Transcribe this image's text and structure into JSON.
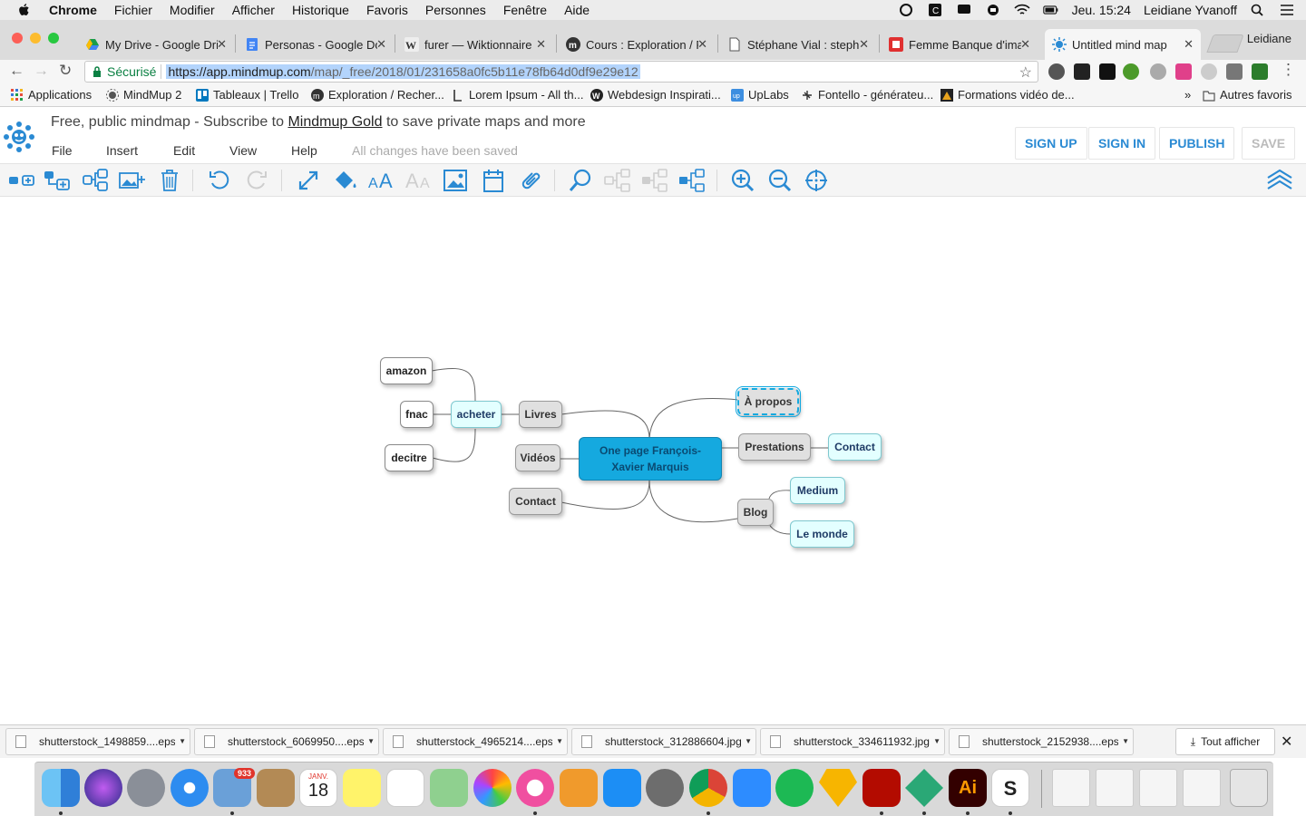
{
  "menubar": {
    "app_name": "Chrome",
    "items": [
      "Fichier",
      "Modifier",
      "Afficher",
      "Historique",
      "Favoris",
      "Personnes",
      "Fenêtre",
      "Aide"
    ],
    "datetime": "Jeu. 15:24",
    "user": "Leidiane Yvanoff"
  },
  "tabs": [
    {
      "title": "My Drive - Google Dri",
      "favicon_color": "#1a9c4a"
    },
    {
      "title": "Personas - Google Do",
      "favicon_color": "#4285f4"
    },
    {
      "title": "furer — Wiktionnaire",
      "favicon_color": "#777777"
    },
    {
      "title": "Cours : Exploration / F",
      "favicon_color": "#333333"
    },
    {
      "title": "Stéphane Vial : stepha",
      "favicon_color": "#ffffff"
    },
    {
      "title": "Femme Banque d'imag",
      "favicon_color": "#e03030"
    },
    {
      "title": "Untitled mind map",
      "favicon_color": "#2a8ad3"
    }
  ],
  "profile_name": "Leidiane",
  "omnibox": {
    "secure_label": "Sécurisé",
    "url_host": "https://app.mindmup.com",
    "url_path": "/map/_free/2018/01/231658a0fc5b11e78fb64d0df9e29e12"
  },
  "bookmarks": [
    {
      "label": "Applications",
      "icon": "apps-grid-icon",
      "color": "#e74c3c"
    },
    {
      "label": "MindMup 2",
      "icon": "mindmup-icon",
      "color": "#2a8ad3"
    },
    {
      "label": "Tableaux | Trello",
      "icon": "trello-icon",
      "color": "#0079bf"
    },
    {
      "label": "Exploration / Recher...",
      "icon": "moodle-icon",
      "color": "#333333"
    },
    {
      "label": "Lorem Ipsum - All th...",
      "icon": "lorem-icon",
      "color": "#444444"
    },
    {
      "label": "Webdesign Inspirati...",
      "icon": "webdesign-icon",
      "color": "#222222"
    },
    {
      "label": "UpLabs",
      "icon": "uplabs-icon",
      "color": "#3d8ee0"
    },
    {
      "label": "Fontello - générateu...",
      "icon": "fontello-icon",
      "color": "#333333"
    },
    {
      "label": "Formations vidéo de...",
      "icon": "video-icon",
      "color": "#e8a41d"
    }
  ],
  "bookmarks_more": "»",
  "bookmarks_other": "Autres favoris",
  "mindmup": {
    "promo_before": "Free, public mindmap - Subscribe to",
    "promo_link": "Mindmup Gold",
    "promo_after": "to save private maps and more",
    "menu": [
      "File",
      "Insert",
      "Edit",
      "View",
      "Help"
    ],
    "status": "All changes have been saved",
    "buttons": {
      "signup": "SIGN UP",
      "signin": "SIGN IN",
      "publish": "PUBLISH",
      "save": "SAVE"
    },
    "accent_color": "#2a8ad3"
  },
  "mindmap": {
    "root": "One page François-Xavier Marquis",
    "nodes": {
      "amazon": "amazon",
      "fnac": "fnac",
      "decitre": "decitre",
      "acheter": "acheter",
      "livres": "Livres",
      "videos": "Vidéos",
      "contact_left": "Contact",
      "apropos": "À propos",
      "prestations": "Prestations",
      "contact_right": "Contact",
      "blog": "Blog",
      "medium": "Medium",
      "lemonde": "Le monde"
    }
  },
  "downloads": [
    "shutterstock_1498859....eps",
    "shutterstock_6069950....eps",
    "shutterstock_4965214....eps",
    "shutterstock_312886604.jpg",
    "shutterstock_334611932.jpg",
    "shutterstock_2152938....eps"
  ],
  "downloads_show_all": "Tout afficher",
  "dock": {
    "mail_badge": "933",
    "calendar_month": "JANV.",
    "calendar_day": "18"
  }
}
